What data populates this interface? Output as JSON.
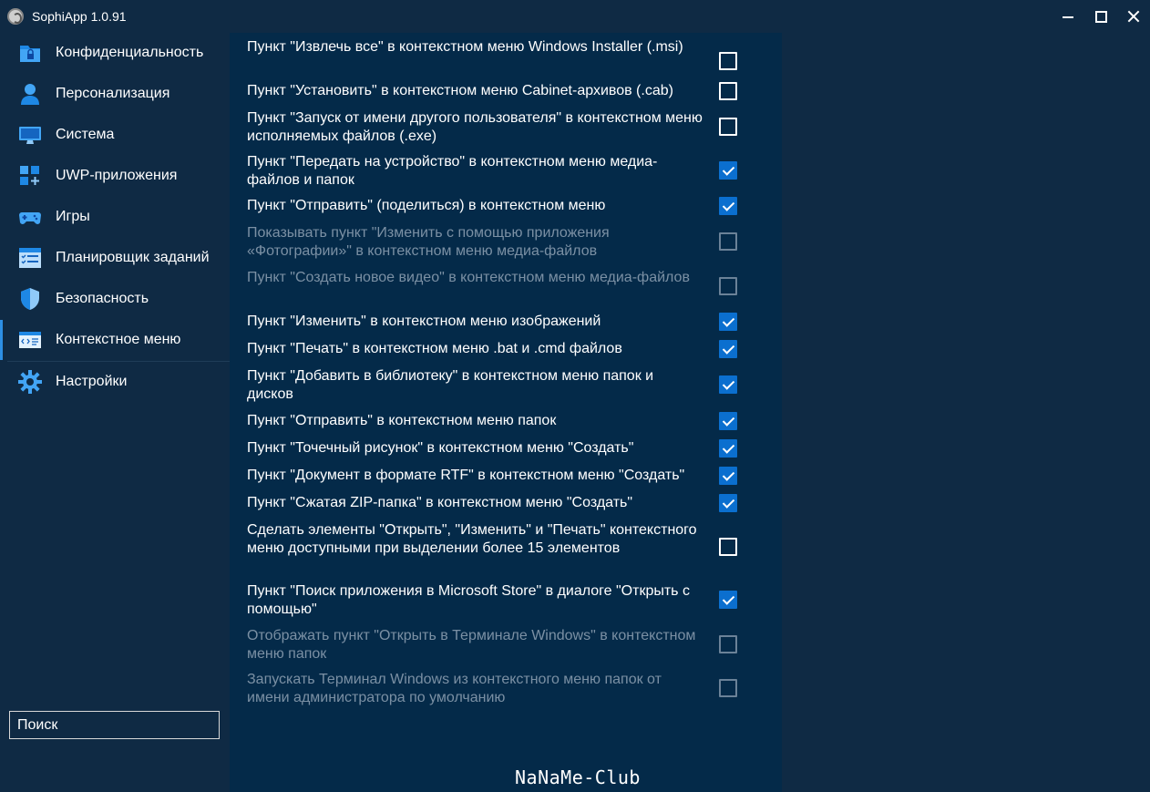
{
  "window": {
    "title": "SophiApp 1.0.91"
  },
  "sidebar": {
    "items": [
      {
        "label": "Конфиденциальность",
        "icon": "lock-folder-icon",
        "active": false
      },
      {
        "label": "Персонализация",
        "icon": "user-icon",
        "active": false
      },
      {
        "label": "Система",
        "icon": "monitor-icon",
        "active": false
      },
      {
        "label": "UWP-приложения",
        "icon": "apps-grid-icon",
        "active": false
      },
      {
        "label": "Игры",
        "icon": "gamepad-icon",
        "active": false
      },
      {
        "label": "Планировщик заданий",
        "icon": "task-list-icon",
        "active": false
      },
      {
        "label": "Безопасность",
        "icon": "shield-icon",
        "active": false
      },
      {
        "label": "Контекстное меню",
        "icon": "context-menu-icon",
        "active": true
      },
      {
        "label": "Настройки",
        "icon": "gear-icon",
        "active": false
      }
    ],
    "search": {
      "placeholder": "Поиск",
      "value": ""
    }
  },
  "settings": [
    {
      "text": "Пункт \"Извлечь все\" в контекстном меню Windows Installer (.msi)",
      "checked": false,
      "enabled": true
    },
    {
      "text": "Пункт \"Установить\" в контекстном меню Cabinet-архивов (.cab)",
      "checked": false,
      "enabled": true
    },
    {
      "text": "Пункт \"Запуск от имени другого пользователя\" в контекстном меню исполняемых файлов (.exe)",
      "checked": false,
      "enabled": true
    },
    {
      "text": "Пункт \"Передать на устройство\" в контекстном меню медиа-файлов и папок",
      "checked": true,
      "enabled": true
    },
    {
      "text": "Пункт \"Отправить\" (поделиться) в контекстном меню",
      "checked": true,
      "enabled": true
    },
    {
      "text": "Показывать пункт \"Изменить с помощью приложения «Фотографии»\" в контекстном меню медиа-файлов",
      "checked": false,
      "enabled": false
    },
    {
      "text": "Пункт \"Создать новое видео\" в контекстном меню медиа-файлов",
      "checked": false,
      "enabled": false
    },
    {
      "text": "Пункт \"Изменить\" в контекстном меню изображений",
      "checked": true,
      "enabled": true
    },
    {
      "text": "Пункт \"Печать\" в контекстном меню .bat и .cmd файлов",
      "checked": true,
      "enabled": true
    },
    {
      "text": "Пункт \"Добавить в библиотеку\" в контекстном меню папок и дисков",
      "checked": true,
      "enabled": true
    },
    {
      "text": "Пункт \"Отправить\" в контекстном меню папок",
      "checked": true,
      "enabled": true
    },
    {
      "text": "Пункт \"Точечный рисунок\" в контекстном меню \"Создать\"",
      "checked": true,
      "enabled": true
    },
    {
      "text": "Пункт \"Документ в формате RTF\" в контекстном меню \"Создать\"",
      "checked": true,
      "enabled": true
    },
    {
      "text": "Пункт \"Сжатая ZIP-папка\" в контекстном меню \"Создать\"",
      "checked": true,
      "enabled": true
    },
    {
      "text": "Сделать элементы \"Открыть\", \"Изменить\" и \"Печать\" контекстного меню доступными при выделении более 15 элементов",
      "checked": false,
      "enabled": true
    },
    {
      "text": "Пункт \"Поиск приложения в Microsoft Store\" в диалоге \"Открыть с помощью\"",
      "checked": true,
      "enabled": true
    },
    {
      "text": "Отображать пункт \"Открыть в Терминале Windows\" в контекстном меню папок",
      "checked": false,
      "enabled": false
    },
    {
      "text": "Запускать Терминал Windows из контекстного меню папок от имени администратора по умолчанию",
      "checked": false,
      "enabled": false
    }
  ],
  "watermark": "NaNaMe-Club",
  "colors": {
    "background": "#0f2a44",
    "content_background": "#042a49",
    "accent": "#0b6fcf",
    "disabled_text": "#7b90a4"
  }
}
